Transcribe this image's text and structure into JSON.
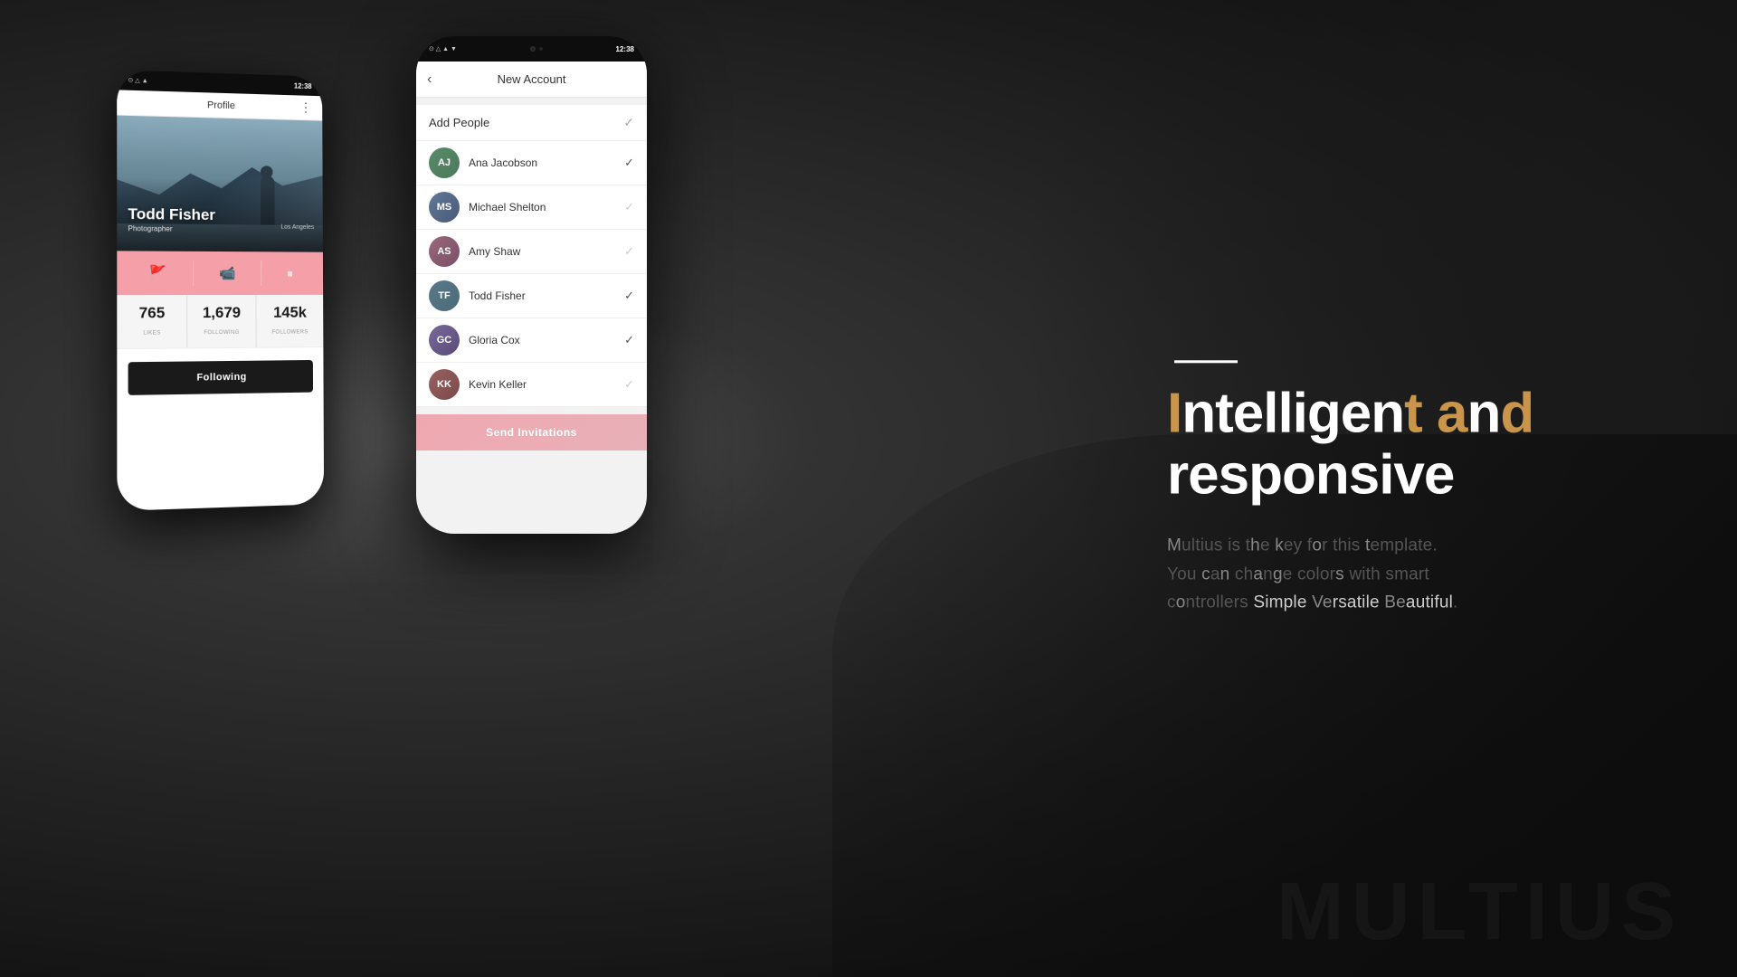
{
  "background": {
    "color": "#1a1a1a"
  },
  "phone1": {
    "screen_title": "Profile",
    "status_time": "12:38",
    "profile": {
      "name": "Todd Fisher",
      "title": "Photographer",
      "location": "Los Angeles",
      "stats": {
        "likes": "765",
        "likes_label": "LIKES",
        "following": "1,679",
        "following_label": "FOLLOWING",
        "followers": "145k",
        "followers_label": "FOLLOWERS"
      },
      "following_button": "Following"
    }
  },
  "phone2": {
    "screen_title": "New Account",
    "status_time": "12:38",
    "add_people_title": "Add People",
    "people": [
      {
        "name": "Ana Jacobson",
        "checked": true,
        "initials": "AJ",
        "color": "av-green"
      },
      {
        "name": "Michael Shelton",
        "checked": false,
        "initials": "MS",
        "color": "av-blue"
      },
      {
        "name": "Amy Shaw",
        "checked": false,
        "initials": "AS",
        "color": "av-pink"
      },
      {
        "name": "Todd Fisher",
        "checked": true,
        "initials": "TF",
        "color": "av-teal"
      },
      {
        "name": "Gloria Cox",
        "checked": true,
        "initials": "GC",
        "color": "av-purple"
      },
      {
        "name": "Kevin Keller",
        "checked": false,
        "initials": "KK",
        "color": "av-red"
      }
    ],
    "send_button": "Send Invitations"
  },
  "right_content": {
    "heading_line1": "Intelligent and",
    "heading_line2": "responsive",
    "highlighted_words": [
      "I",
      "t",
      "a",
      "d"
    ],
    "subtext": "Multius is the key for this template. You can change colors with smart controllers Simple Versatile Beautiful.",
    "watermark": "MULTIUS"
  }
}
